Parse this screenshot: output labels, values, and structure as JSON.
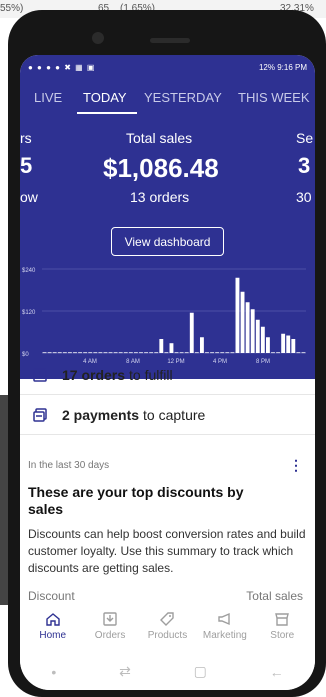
{
  "background": {
    "strip": [
      "55%)",
      "65",
      "(1.65%)",
      "32.31%"
    ]
  },
  "status_bar": {
    "left_icons": "● ● ● ● ✖ ▦ ▣",
    "right_text": "12% 9:16 PM"
  },
  "tabs": [
    {
      "label": "LIVE",
      "active": false
    },
    {
      "label": "TODAY",
      "active": true
    },
    {
      "label": "YESTERDAY",
      "active": false
    },
    {
      "label": "THIS WEEK",
      "active": false
    }
  ],
  "metrics": {
    "left": {
      "label": "rs",
      "value": "5",
      "sub": "ow"
    },
    "center": {
      "label": "Total sales",
      "value": "$1,086.48",
      "sub": "13 orders"
    },
    "right": {
      "label": "Se",
      "value": "3",
      "sub": "30"
    }
  },
  "view_dashboard_label": "View dashboard",
  "chart_data": {
    "type": "bar",
    "x_ticks": [
      "4 AM",
      "8 AM",
      "12 PM",
      "4 PM",
      "8 PM"
    ],
    "y_ticks": [
      "$240",
      "$120",
      "$0"
    ],
    "ylim": [
      0,
      240
    ],
    "values": [
      2,
      2,
      2,
      2,
      2,
      2,
      2,
      2,
      2,
      2,
      2,
      2,
      2,
      2,
      2,
      2,
      2,
      2,
      2,
      2,
      2,
      2,
      2,
      40,
      2,
      28,
      2,
      2,
      2,
      115,
      2,
      45,
      2,
      2,
      2,
      2,
      2,
      2,
      215,
      175,
      145,
      125,
      95,
      75,
      45,
      2,
      2,
      55,
      50,
      40,
      2,
      2
    ],
    "colors": {
      "bar": "#ffffff",
      "grid": "#6b6fb8"
    }
  },
  "todos": [
    {
      "bold": "17 orders",
      "rest": "to fulfill",
      "icon": "inbox-icon"
    },
    {
      "bold": "2 payments",
      "rest": "to capture",
      "icon": "payment-icon"
    }
  ],
  "discount_card": {
    "caption": "In the last 30 days",
    "title": "These are your top discounts by sales",
    "text": "Discounts can help boost conversion rates and build customer loyalty. Use this summary to track which discounts are getting sales.",
    "col_left": "Discount",
    "col_right": "Total sales"
  },
  "bottom_nav": [
    {
      "label": "Home",
      "active": true,
      "icon": "home-icon"
    },
    {
      "label": "Orders",
      "active": false,
      "icon": "orders-icon"
    },
    {
      "label": "Products",
      "active": false,
      "icon": "products-icon"
    },
    {
      "label": "Marketing",
      "active": false,
      "icon": "marketing-icon"
    },
    {
      "label": "Store",
      "active": false,
      "icon": "store-icon"
    }
  ],
  "system_nav": [
    "•",
    "⇄",
    "▢",
    "←"
  ],
  "colors": {
    "brand": "#2e3192"
  }
}
